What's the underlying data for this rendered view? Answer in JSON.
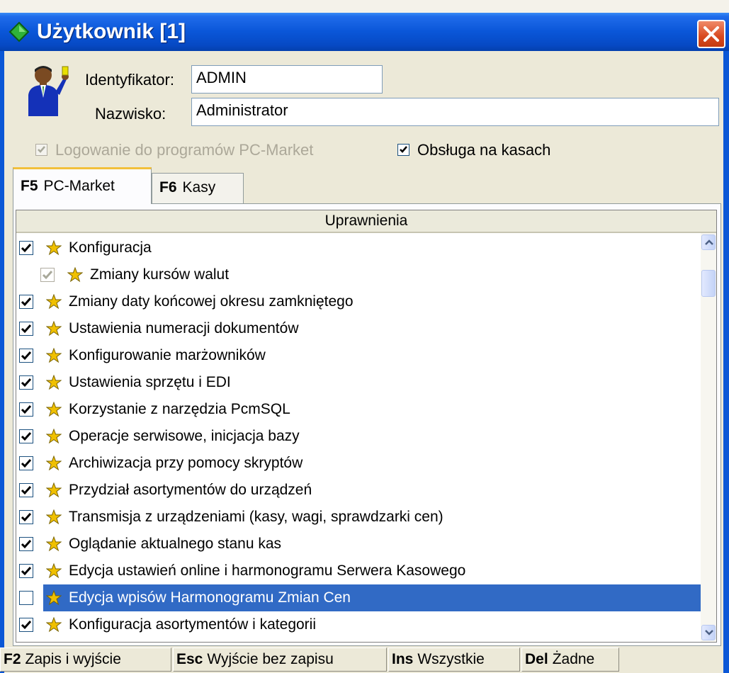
{
  "window": {
    "title": "Użytkownik [1]"
  },
  "form": {
    "identifier_label": "Identyfikator:",
    "identifier_value": "ADMIN",
    "surname_label": "Nazwisko:",
    "surname_value": "Administrator",
    "login_checkbox": {
      "label": "Logowanie do programów PC-Market",
      "checked": true,
      "disabled": true
    },
    "pos_checkbox": {
      "label": "Obsługa na kasach",
      "checked": true
    }
  },
  "tabs": [
    {
      "key": "F5",
      "label": "PC-Market",
      "active": true
    },
    {
      "key": "F6",
      "label": "Kasy",
      "active": false
    }
  ],
  "grid": {
    "header": "Uprawnienia",
    "rows": [
      {
        "label": "Konfiguracja",
        "checked": true,
        "indent": 0
      },
      {
        "label": "Zmiany kursów walut",
        "checked": true,
        "disabled": true,
        "indent": 1
      },
      {
        "label": "Zmiany daty końcowej okresu zamkniętego",
        "checked": true,
        "indent": 0
      },
      {
        "label": "Ustawienia numeracji dokumentów",
        "checked": true,
        "indent": 0
      },
      {
        "label": "Konfigurowanie marżowników",
        "checked": true,
        "indent": 0
      },
      {
        "label": "Ustawienia sprzętu i EDI",
        "checked": true,
        "indent": 0
      },
      {
        "label": "Korzystanie z narzędzia PcmSQL",
        "checked": true,
        "indent": 0
      },
      {
        "label": "Operacje serwisowe, inicjacja bazy",
        "checked": true,
        "indent": 0
      },
      {
        "label": "Archiwizacja przy pomocy skryptów",
        "checked": true,
        "indent": 0
      },
      {
        "label": "Przydział asortymentów do urządzeń",
        "checked": true,
        "indent": 0
      },
      {
        "label": "Transmisja z urządzeniami (kasy, wagi, sprawdzarki cen)",
        "checked": true,
        "indent": 0
      },
      {
        "label": "Oglądanie aktualnego stanu kas",
        "checked": true,
        "indent": 0
      },
      {
        "label": "Edycja ustawień online i harmonogramu Serwera Kasowego",
        "checked": true,
        "indent": 0
      },
      {
        "label": "Edycja wpisów Harmonogramu Zmian Cen",
        "checked": false,
        "indent": 0,
        "selected": true
      },
      {
        "label": "Konfiguracja asortymentów i kategorii",
        "checked": true,
        "indent": 0
      }
    ]
  },
  "footer": [
    {
      "key": "F2",
      "label": "Zapis i wyjście"
    },
    {
      "key": "Esc",
      "label": "Wyjście bez zapisu"
    },
    {
      "key": "Ins",
      "label": "Wszystkie"
    },
    {
      "key": "Del",
      "label": "Żadne"
    }
  ],
  "colors": {
    "titlebar": "#0a56d8",
    "selection": "#316ac5",
    "star": "#f0c000",
    "close": "#d84a20"
  },
  "icons": {
    "window": "app-diamond-icon",
    "close": "close-icon",
    "user": "user-avatar-icon",
    "row": "star-icon"
  }
}
